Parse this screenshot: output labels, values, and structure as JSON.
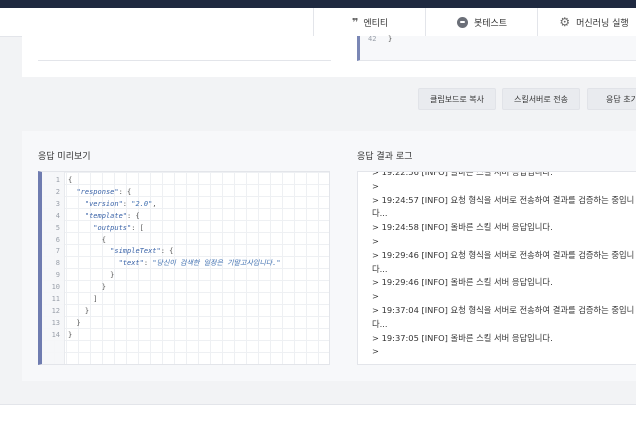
{
  "header": {
    "tabs": [
      {
        "label": "엔티티",
        "icon": "quote-icon"
      },
      {
        "label": "봇테스트",
        "icon": "bot-icon"
      },
      {
        "label": "머신러닝 실행",
        "icon": "gear-icon"
      }
    ]
  },
  "top_editor": {
    "line_number": "42",
    "code": "}"
  },
  "buttons": {
    "copy_clipboard": "클립보드로 복사",
    "send_to_server": "스킬서버로 전송",
    "reset_response": "응답 초기"
  },
  "preview": {
    "title": "응답 미리보기",
    "lines": [
      {
        "num": "1",
        "html": "{"
      },
      {
        "num": "2",
        "html": "  <span class='k'>\"response\"</span>: {"
      },
      {
        "num": "3",
        "html": "    <span class='k'>\"version\"</span>: <span class='s'>\"2.0\"</span>,"
      },
      {
        "num": "4",
        "html": "    <span class='k'>\"template\"</span>: {"
      },
      {
        "num": "5",
        "html": "      <span class='k'>\"outputs\"</span>: ["
      },
      {
        "num": "6",
        "html": "        {"
      },
      {
        "num": "7",
        "html": "          <span class='k'>\"simpleText\"</span>: {"
      },
      {
        "num": "8",
        "html": "            <span class='k'>\"text\"</span>: <span class='s'>\"당신이 검색한 일정은 기말고사입니다.\"</span>"
      },
      {
        "num": "9",
        "html": "          }"
      },
      {
        "num": "10",
        "html": "        }"
      },
      {
        "num": "11",
        "html": "      ]"
      },
      {
        "num": "12",
        "html": "    }"
      },
      {
        "num": "13",
        "html": "  }"
      },
      {
        "num": "14",
        "html": "}"
      }
    ]
  },
  "log": {
    "title": "응답 결과 로그",
    "lines": [
      "> 19:22:56 [INFO] 올바른 스킬 서버 응답입니다.",
      ">",
      "> 19:24:57 [INFO] 요청 형식을 서버로 전송하여 결과를 검증하는 중입니다...",
      "> 19:24:58 [INFO] 올바른 스킬 서버 응답입니다.",
      ">",
      "> 19:29:46 [INFO] 요청 형식을 서버로 전송하여 결과를 검증하는 중입니다...",
      "> 19:29:46 [INFO] 올바른 스킬 서버 응답입니다.",
      ">",
      "> 19:37:04 [INFO] 요청 형식을 서버로 전송하여 결과를 검증하는 중입니다...",
      "> 19:37:05 [INFO] 올바른 스킬 서버 응답입니다.",
      ">"
    ]
  }
}
